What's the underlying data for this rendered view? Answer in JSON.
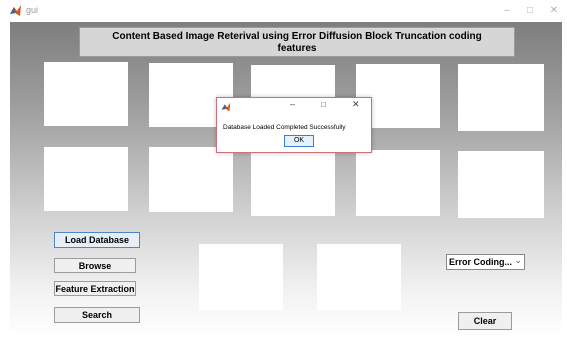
{
  "window": {
    "title": "gui",
    "minimize_glyph": "–",
    "maximize_glyph": "□",
    "close_glyph": "✕"
  },
  "header": {
    "line1": "Content Based Image Reterival using Error Diffusion Block Truncation coding",
    "line2": "features"
  },
  "buttons": {
    "load_database": "Load Database",
    "browse": "Browse",
    "feature_extraction": "Feature Extraction",
    "search": "Search",
    "clear": "Clear"
  },
  "method_select": {
    "selected": "Error Coding...",
    "chevron": "⌄"
  },
  "dialog": {
    "message": "Database Loaded Completed Successfully",
    "ok_label": "OK",
    "minimize_glyph": "–",
    "maximize_glyph": "□",
    "close_glyph": "✕"
  },
  "colors": {
    "matlab_icon": "#d9541e",
    "dialog_border": "#c8727e",
    "ok_border": "#3c7fd2"
  }
}
